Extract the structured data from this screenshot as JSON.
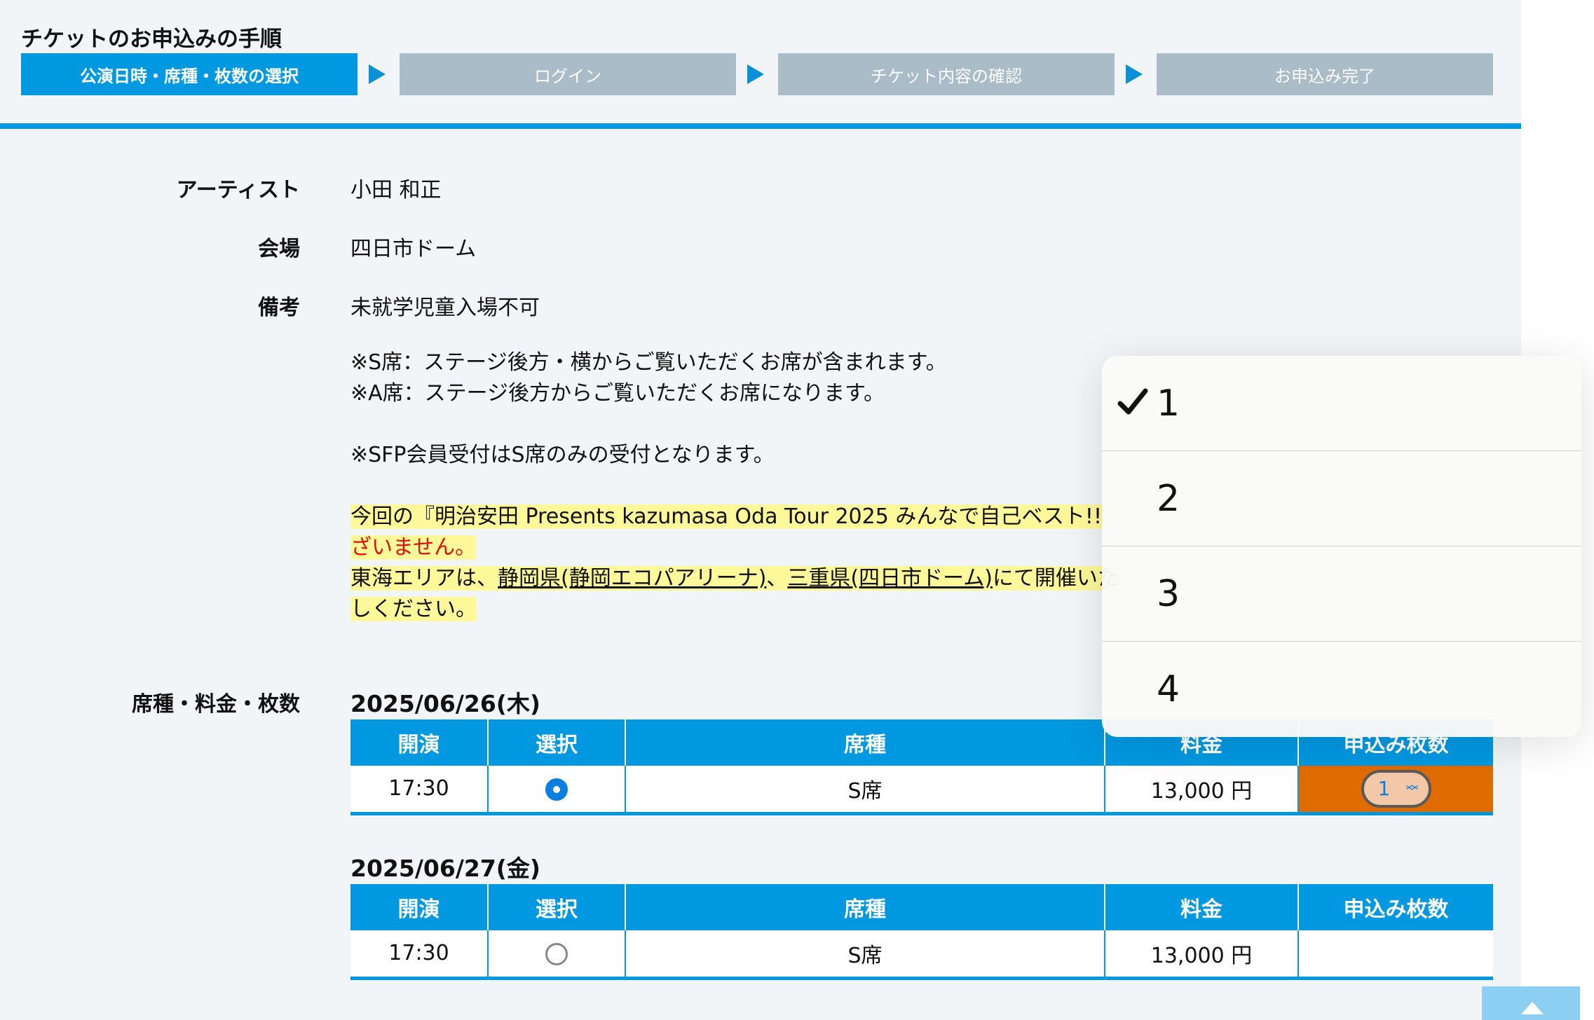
{
  "steps": {
    "title": "チケットのお申込みの手順",
    "items": [
      {
        "label": "公演日時・席種・枚数の選択"
      },
      {
        "label": "ログイン"
      },
      {
        "label": "チケット内容の確認"
      },
      {
        "label": "お申込み完了"
      }
    ]
  },
  "info": {
    "artist_label": "アーティスト",
    "artist_value": "小田 和正",
    "venue_label": "会場",
    "venue_value": "四日市ドーム",
    "remarks_label": "備考",
    "remarks_line1": "未就学児童入場不可",
    "remarks_line2": "※S席：ステージ後方・横からご覧いただくお席が含まれます。",
    "remarks_line3": "※A席：ステージ後方からご覧いただくお席になります。",
    "remarks_line4": "※SFP会員受付はS席のみの受付となります。",
    "hl_line1": "今回の『明治安田 Presents kazumasa Oda Tour 2025 みんなで自己ベスト!!",
    "hl_line2_red": "ざいません。",
    "hl_line3_prefix": "東海エリアは、",
    "hl_line3_link1": "静岡県(静岡エコパアリーナ)",
    "hl_line3_sep": "、",
    "hl_line3_link2": "三重県(四日市ドーム)",
    "hl_line3_suffix": "にて開催いた",
    "hl_line4": "しください。"
  },
  "seat_section": {
    "label": "席種・料金・枚数",
    "headers": [
      "開演",
      "選択",
      "席種",
      "料金",
      "申込み枚数"
    ],
    "shows": [
      {
        "date": "2025/06/26(木)",
        "time": "17:30",
        "seat": "S席",
        "price": "13,000 円",
        "qty": "1",
        "selected": true
      },
      {
        "date": "2025/06/27(金)",
        "time": "17:30",
        "seat": "S席",
        "price": "13,000 円",
        "qty": "",
        "selected": false
      }
    ]
  },
  "dropdown": {
    "options": [
      "1",
      "2",
      "3",
      "4"
    ],
    "selected": "1"
  },
  "colors": {
    "accent": "#0098e0",
    "step_inactive": "#a9bcc8",
    "highlight": "#fdf89a",
    "qty_active": "#e06c00"
  }
}
